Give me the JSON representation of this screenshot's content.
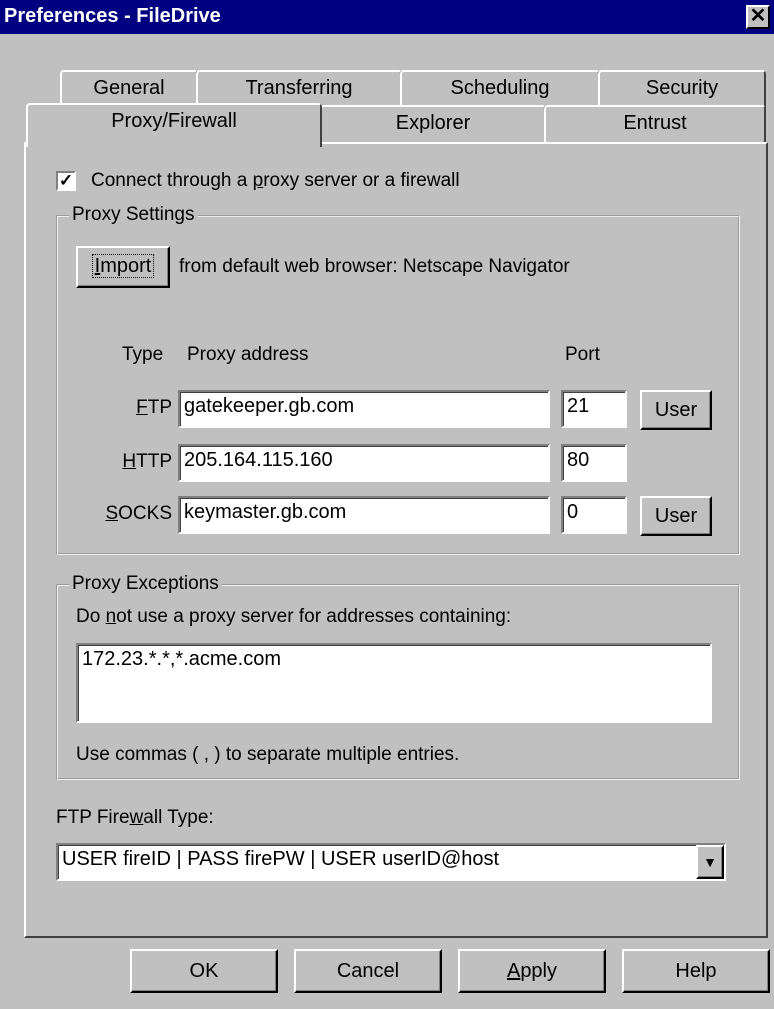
{
  "window": {
    "title": "Preferences - FileDrive",
    "close_glyph": "✕"
  },
  "tabs": {
    "row1": [
      "General",
      "Transferring",
      "Scheduling",
      "Security"
    ],
    "row2": [
      "Proxy/Firewall",
      "Explorer",
      "Entrust"
    ],
    "active": "Proxy/Firewall"
  },
  "proxy": {
    "enabled_checked": true,
    "enable_label_pre": "Connect through a ",
    "enable_label_u": "p",
    "enable_label_post": "roxy server or a firewall",
    "settings_legend": "Proxy Settings",
    "import_button_u": "I",
    "import_button_rest": "mport",
    "import_text": "from default web browser: Netscape Navigator",
    "col_type": "Type",
    "col_address": "Proxy address",
    "col_port": "Port",
    "rows": [
      {
        "type_u": "F",
        "type_rest": "TP",
        "address": "gatekeeper.gb.com",
        "port": "21",
        "user_button": "User"
      },
      {
        "type_u": "H",
        "type_rest": "TTP",
        "address": "205.164.115.160",
        "port": "80",
        "user_button": ""
      },
      {
        "type_u": "S",
        "type_rest": "OCKS",
        "address": "keymaster.gb.com",
        "port": "0",
        "user_button": "User"
      }
    ]
  },
  "exceptions": {
    "legend": "Proxy Exceptions",
    "desc_pre": "Do ",
    "desc_u": "n",
    "desc_post": "ot use a proxy server for addresses containing:",
    "value": "172.23.*.*,*.acme.com",
    "hint": "Use commas ( , ) to separate multiple entries."
  },
  "firewall": {
    "label_pre": "FTP Fire",
    "label_u": "w",
    "label_post": "all Type:",
    "selected": "USER fireID | PASS firePW | USER userID@host",
    "arrow_glyph": "▼"
  },
  "buttons": {
    "ok": "OK",
    "cancel": "Cancel",
    "apply_u": "A",
    "apply_rest": "pply",
    "help": "Help"
  }
}
